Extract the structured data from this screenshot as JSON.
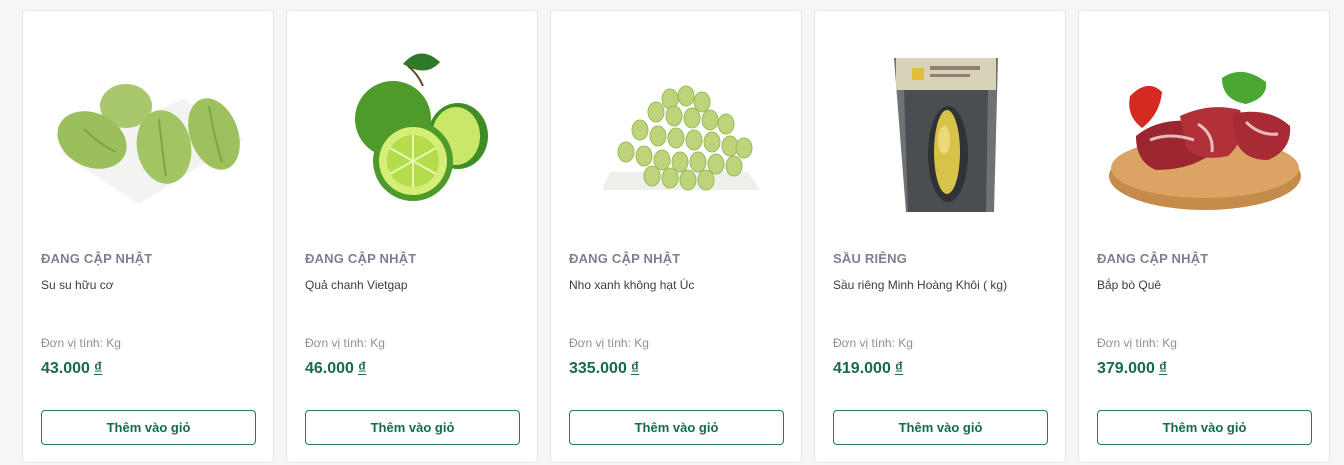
{
  "products": [
    {
      "category": "ĐANG CẬP NHẬT",
      "name": "Su su hữu cơ",
      "unit": "Đơn vị tính: Kg",
      "price": "43.000",
      "currency": "₫",
      "button": "Thêm vào giỏ",
      "image": "chayote-image"
    },
    {
      "category": "ĐANG CẬP NHẬT",
      "name": "Quả chanh Vietgap",
      "unit": "Đơn vị tính: Kg",
      "price": "46.000",
      "currency": "₫",
      "button": "Thêm vào giỏ",
      "image": "lime-image"
    },
    {
      "category": "ĐANG CẬP NHẬT",
      "name": "Nho xanh không hạt Úc",
      "unit": "Đơn vị tính: Kg",
      "price": "335.000",
      "currency": "₫",
      "button": "Thêm vào giỏ",
      "image": "green-grapes-image"
    },
    {
      "category": "SẦU RIÊNG",
      "name": "Sầu riêng Minh Hoàng Khôi ( kg)",
      "unit": "Đơn vị tính: Kg",
      "price": "419.000",
      "currency": "₫",
      "button": "Thêm vào giỏ",
      "image": "durian-pack-image"
    },
    {
      "category": "ĐANG CẬP NHẬT",
      "name": "Bắp bò Quê",
      "unit": "Đơn vị tính: Kg",
      "price": "379.000",
      "currency": "₫",
      "button": "Thêm vào giỏ",
      "image": "beef-shank-image"
    }
  ],
  "colors": {
    "accent": "#176b45",
    "border": "#237a52",
    "category": "#7b8094"
  }
}
